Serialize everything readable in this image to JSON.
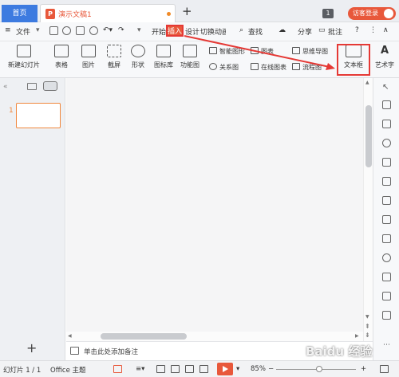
{
  "titlebar": {
    "home_tab": "首页",
    "doc_tab": "演示文稿1",
    "doc_icon_letter": "P",
    "page_badge": "1",
    "login_label": "访客登录"
  },
  "menu": {
    "file": "文件",
    "tabs": [
      "开始",
      "插入",
      "设计",
      "切换",
      "动画"
    ],
    "search": "查找",
    "share": "分享",
    "comment": "批注",
    "help": "?"
  },
  "ribbon": {
    "new_slide": "新建幻灯片",
    "table": "表格",
    "picture": "图片",
    "screenshot": "截屏",
    "shape": "形状",
    "icon_lib": "图标库",
    "function_chart": "功能图",
    "smart_graphic": "智能图形",
    "chart": "图表",
    "mind_map": "思维导图",
    "relation_chart": "关系图",
    "online_chart": "在线图表",
    "flowchart": "流程图",
    "text_box": "文本框",
    "art_text": "艺术字"
  },
  "slides": {
    "thumb_number": "1",
    "add": "+"
  },
  "notes": {
    "placeholder": "单击此处添加备注"
  },
  "status": {
    "slide_count": "幻灯片 1 / 1",
    "theme": "Office 主题",
    "zoom": "85%",
    "minus": "−",
    "plus": "+"
  },
  "colors": {
    "accent": "#e8583b",
    "home_tab": "#3d7be0",
    "highlight": "#e53935"
  },
  "watermark": "Baidu 经验"
}
